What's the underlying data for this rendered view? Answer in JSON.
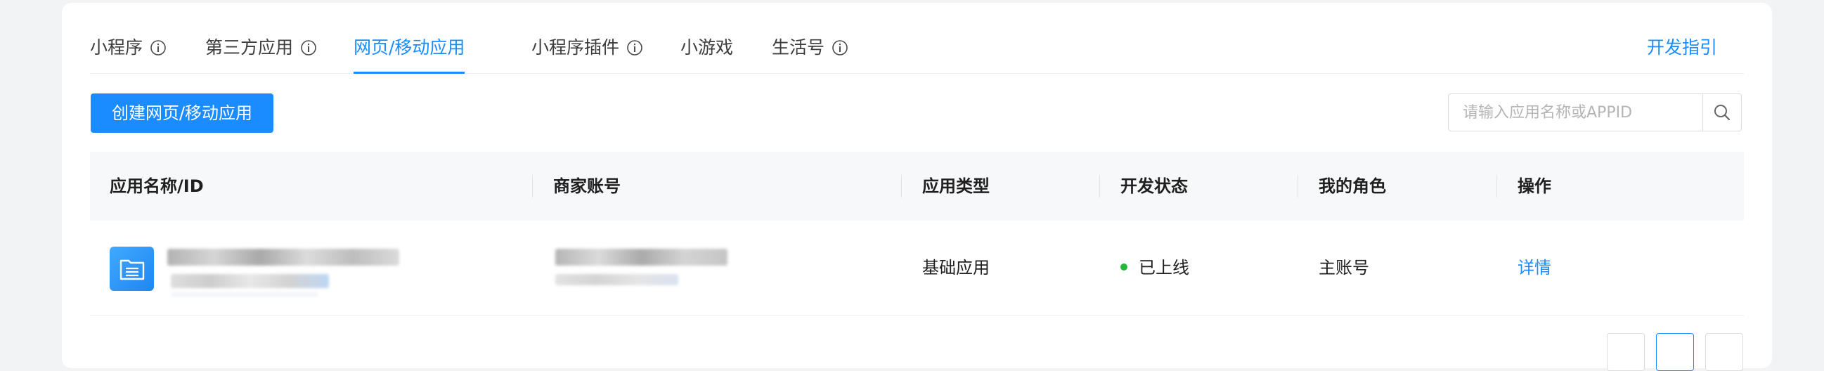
{
  "tabs": [
    {
      "label": "小程序",
      "has_info": true,
      "active": false
    },
    {
      "label": "第三方应用",
      "has_info": true,
      "active": false
    },
    {
      "label": "网页/移动应用",
      "has_info": false,
      "active": true
    },
    {
      "label": "小程序插件",
      "has_info": true,
      "active": false
    },
    {
      "label": "小游戏",
      "has_info": false,
      "active": false
    },
    {
      "label": "生活号",
      "has_info": true,
      "active": false
    }
  ],
  "dev_guide_label": "开发指引",
  "create_button_label": "创建网页/移动应用",
  "search": {
    "placeholder": "请输入应用名称或APPID",
    "value": ""
  },
  "table": {
    "columns": [
      "应用名称/ID",
      "商家账号",
      "应用类型",
      "开发状态",
      "我的角色",
      "操作"
    ],
    "rows": [
      {
        "app_name": "",
        "app_id": "",
        "merchant_account": "",
        "app_type": "基础应用",
        "dev_status": "已上线",
        "role": "主账号",
        "action": "详情"
      }
    ]
  },
  "colors": {
    "accent": "#1a8cff",
    "status_online": "#1fba3a"
  },
  "icons": {
    "info": "info-circle-icon",
    "search": "search-icon",
    "app": "document-folder-icon"
  }
}
